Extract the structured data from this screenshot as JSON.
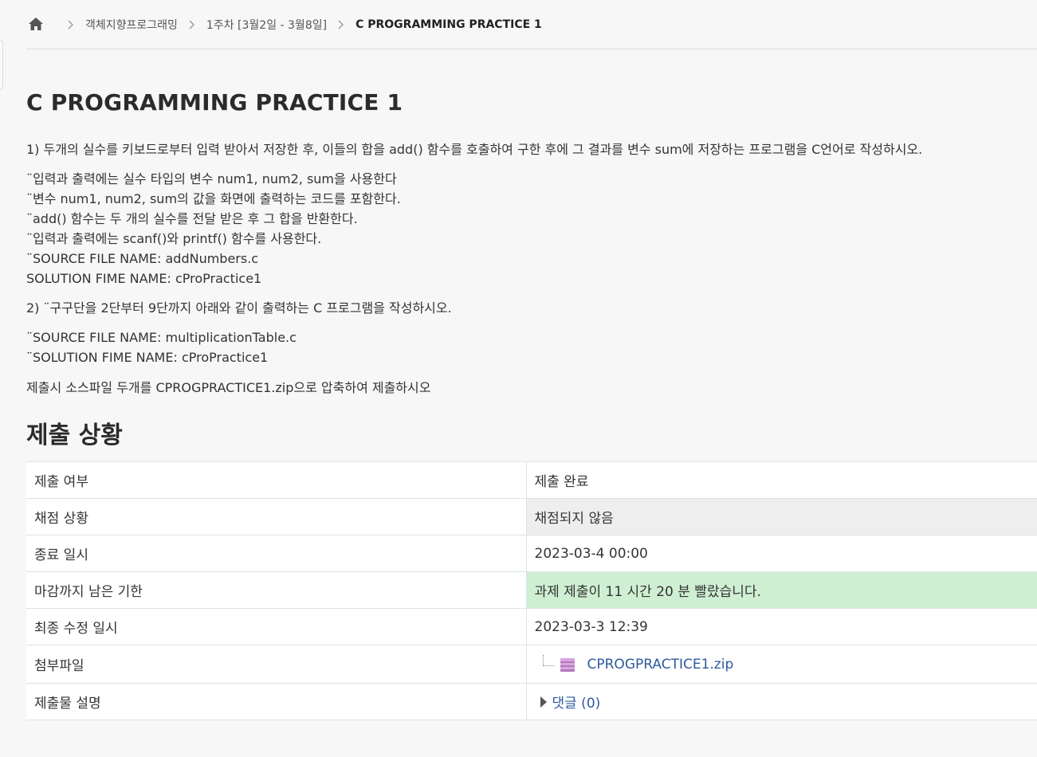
{
  "breadcrumb": {
    "home_icon": "home-icon",
    "items": [
      "객체지향프로그래밍",
      "1주차 [3월2일 - 3월8일]",
      "C PROGRAMMING PRACTICE 1"
    ]
  },
  "title": "C PROGRAMMING PRACTICE 1",
  "description": {
    "q1": "1)  두개의 실수를 키보드로부터 입력 받아서 저장한 후, 이들의 합을 add() 함수를 호출하여 구한 후에 그 결과를 변수 sum에 저장하는 프로그램을 C언어로 작성하시오.",
    "q1_lines": [
      "¨입력과 출력에는 실수 타입의 변수 num1, num2, sum을 사용한다",
      "¨변수 num1, num2, sum의 값을 화면에 출력하는 코드를 포함한다.",
      "¨add() 함수는 두 개의 실수를 전달 받은 후 그 합을 반환한다.",
      "¨입력과 출력에는 scanf()와 printf() 함수를 사용한다.",
      "¨SOURCE FILE NAME: addNumbers.c",
      "SOLUTION FIME NAME: cProPractice1"
    ],
    "q2": "2) ¨구구단을 2단부터 9단까지 아래와 같이 출력하는 C 프로그램을 작성하시오.",
    "q2_lines": [
      "¨SOURCE FILE NAME:  multiplicationTable.c",
      "¨SOLUTION FIME NAME: cProPractice1"
    ],
    "submit_note": "제출시 소스파일 두개를 CPROGPRACTICE1.zip으로 압축하여 제출하시오"
  },
  "submission": {
    "heading": "제출 상황",
    "rows": [
      {
        "label": "제출 여부",
        "value": "제출 완료"
      },
      {
        "label": "채점 상황",
        "value": "채점되지 않음"
      },
      {
        "label": "종료 일시",
        "value": "2023-03-4 00:00"
      },
      {
        "label": "마감까지 남은 기한",
        "value": "과제 제출이 11 시간 20 분 빨랐습니다."
      },
      {
        "label": "최종 수정 일시",
        "value": "2023-03-3 12:39"
      },
      {
        "label": "첨부파일",
        "value": "CPROGPRACTICE1.zip"
      },
      {
        "label": "제출물 설명",
        "value": "댓글 (0)"
      }
    ]
  },
  "colors": {
    "submitted_text": "#3b7d3f",
    "ungraded_bg": "#eeeeee",
    "early_bg": "#cfefd3",
    "link": "#2e5a9e"
  }
}
